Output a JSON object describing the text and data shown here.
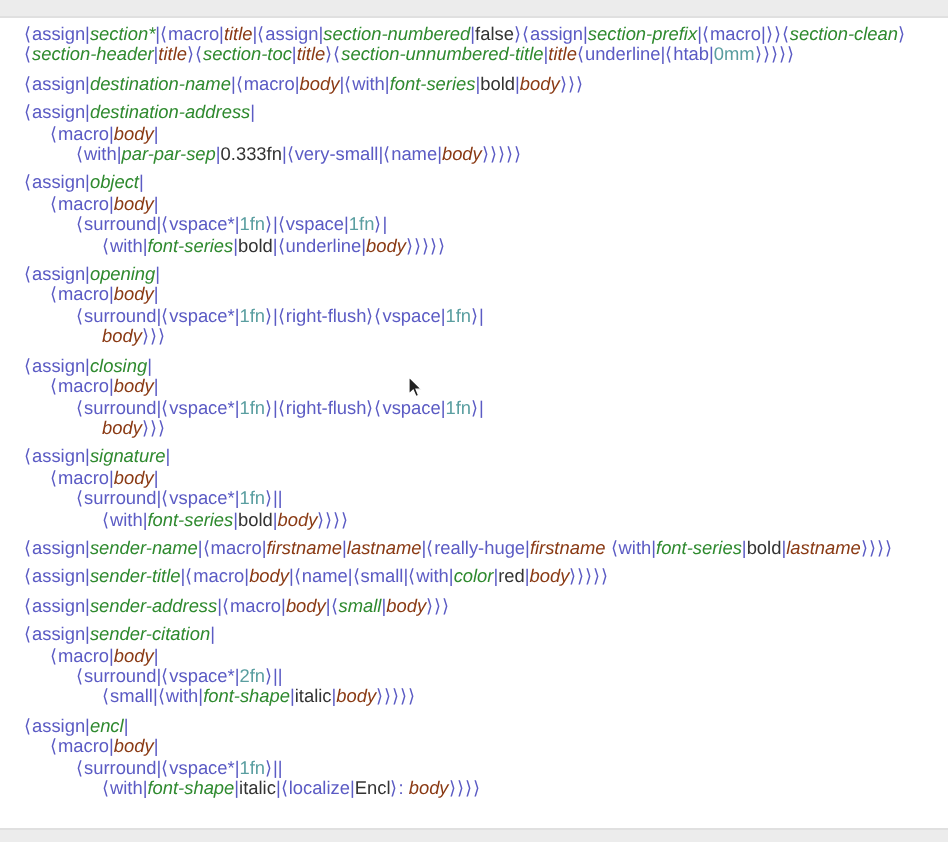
{
  "blocks": [
    {
      "tokens": [
        {
          "kind": "tag",
          "text": "⟨assign|"
        },
        {
          "kind": "var",
          "text": "section*"
        },
        {
          "kind": "tag",
          "text": "|⟨macro|"
        },
        {
          "kind": "arg",
          "text": "title"
        },
        {
          "kind": "tag",
          "text": "|⟨assign|"
        },
        {
          "kind": "var",
          "text": "section-numbered"
        },
        {
          "kind": "tag",
          "text": "|"
        },
        {
          "kind": "plain",
          "text": "false"
        },
        {
          "kind": "tag",
          "text": "⟩⟨assign|"
        },
        {
          "kind": "var",
          "text": "section-prefix"
        },
        {
          "kind": "tag",
          "text": "|⟨macro|⟩⟩⟨"
        },
        {
          "kind": "var",
          "text": "section-clean"
        },
        {
          "kind": "tag",
          "text": "⟩⟨"
        },
        {
          "kind": "var",
          "text": "section-header"
        },
        {
          "kind": "tag",
          "text": "|"
        },
        {
          "kind": "arg",
          "text": "title"
        },
        {
          "kind": "tag",
          "text": "⟩⟨"
        },
        {
          "kind": "var",
          "text": "section-toc"
        },
        {
          "kind": "tag",
          "text": "|"
        },
        {
          "kind": "arg",
          "text": "title"
        },
        {
          "kind": "tag",
          "text": "⟩⟨"
        },
        {
          "kind": "var",
          "text": "section-unnumbered-title"
        },
        {
          "kind": "tag",
          "text": "|"
        },
        {
          "kind": "arg",
          "text": "title"
        },
        {
          "kind": "tag",
          "text": "⟨underline|⟨htab|"
        },
        {
          "kind": "num",
          "text": "0mm"
        },
        {
          "kind": "tag",
          "text": "⟩⟩⟩⟩⟩"
        }
      ]
    },
    {
      "tokens": [
        {
          "kind": "tag",
          "text": "⟨assign|"
        },
        {
          "kind": "var",
          "text": "destination-name"
        },
        {
          "kind": "tag",
          "text": "|⟨macro|"
        },
        {
          "kind": "arg",
          "text": "body"
        },
        {
          "kind": "tag",
          "text": "|⟨with|"
        },
        {
          "kind": "var",
          "text": "font-series"
        },
        {
          "kind": "tag",
          "text": "|"
        },
        {
          "kind": "plain",
          "text": "bold"
        },
        {
          "kind": "tag",
          "text": "|"
        },
        {
          "kind": "arg",
          "text": "body"
        },
        {
          "kind": "tag",
          "text": "⟩⟩⟩"
        }
      ]
    },
    {
      "tokens": [
        {
          "kind": "tag",
          "text": "⟨assign|"
        },
        {
          "kind": "var",
          "text": "destination-address"
        },
        {
          "kind": "tag",
          "text": "|"
        }
      ],
      "children": [
        {
          "tokens": [
            {
              "kind": "tag",
              "text": "⟨macro|"
            },
            {
              "kind": "arg",
              "text": "body"
            },
            {
              "kind": "tag",
              "text": "|"
            }
          ],
          "children": [
            {
              "tokens": [
                {
                  "kind": "tag",
                  "text": "⟨with|"
                },
                {
                  "kind": "var",
                  "text": "par-par-sep"
                },
                {
                  "kind": "tag",
                  "text": "|"
                },
                {
                  "kind": "plain",
                  "text": "0.333fn"
                },
                {
                  "kind": "tag",
                  "text": "|⟨very-small|⟨name|"
                },
                {
                  "kind": "arg",
                  "text": "body"
                },
                {
                  "kind": "tag",
                  "text": "⟩⟩⟩⟩⟩"
                }
              ]
            }
          ]
        }
      ]
    },
    {
      "tokens": [
        {
          "kind": "tag",
          "text": "⟨assign|"
        },
        {
          "kind": "var",
          "text": "object"
        },
        {
          "kind": "tag",
          "text": "|"
        }
      ],
      "children": [
        {
          "tokens": [
            {
              "kind": "tag",
              "text": "⟨macro|"
            },
            {
              "kind": "arg",
              "text": "body"
            },
            {
              "kind": "tag",
              "text": "|"
            }
          ],
          "children": [
            {
              "tokens": [
                {
                  "kind": "tag",
                  "text": "⟨surround|⟨vspace*|"
                },
                {
                  "kind": "num",
                  "text": "1fn"
                },
                {
                  "kind": "tag",
                  "text": "⟩|⟨vspace|"
                },
                {
                  "kind": "num",
                  "text": "1fn"
                },
                {
                  "kind": "tag",
                  "text": "⟩|"
                }
              ],
              "children": [
                {
                  "tokens": [
                    {
                      "kind": "tag",
                      "text": "⟨with|"
                    },
                    {
                      "kind": "var",
                      "text": "font-series"
                    },
                    {
                      "kind": "tag",
                      "text": "|"
                    },
                    {
                      "kind": "plain",
                      "text": "bold"
                    },
                    {
                      "kind": "tag",
                      "text": "|⟨underline|"
                    },
                    {
                      "kind": "arg",
                      "text": "body"
                    },
                    {
                      "kind": "tag",
                      "text": "⟩⟩⟩⟩⟩"
                    }
                  ]
                }
              ]
            }
          ]
        }
      ]
    },
    {
      "tokens": [
        {
          "kind": "tag",
          "text": "⟨assign|"
        },
        {
          "kind": "var",
          "text": "opening"
        },
        {
          "kind": "tag",
          "text": "|"
        }
      ],
      "children": [
        {
          "tokens": [
            {
              "kind": "tag",
              "text": "⟨macro|"
            },
            {
              "kind": "arg",
              "text": "body"
            },
            {
              "kind": "tag",
              "text": "|"
            }
          ],
          "children": [
            {
              "tokens": [
                {
                  "kind": "tag",
                  "text": "⟨surround|⟨vspace*|"
                },
                {
                  "kind": "num",
                  "text": "1fn"
                },
                {
                  "kind": "tag",
                  "text": "⟩|⟨right-flush⟩⟨vspace|"
                },
                {
                  "kind": "num",
                  "text": "1fn"
                },
                {
                  "kind": "tag",
                  "text": "⟩|"
                }
              ],
              "children": [
                {
                  "tokens": [
                    {
                      "kind": "arg",
                      "text": "body"
                    },
                    {
                      "kind": "tag",
                      "text": "⟩⟩⟩"
                    }
                  ]
                }
              ]
            }
          ]
        }
      ]
    },
    {
      "tokens": [
        {
          "kind": "tag",
          "text": "⟨assign|"
        },
        {
          "kind": "var",
          "text": "closing"
        },
        {
          "kind": "tag",
          "text": "|"
        }
      ],
      "children": [
        {
          "tokens": [
            {
              "kind": "tag",
              "text": "⟨macro|"
            },
            {
              "kind": "arg",
              "text": "body"
            },
            {
              "kind": "tag",
              "text": "|"
            }
          ],
          "children": [
            {
              "tokens": [
                {
                  "kind": "tag",
                  "text": "⟨surround|⟨vspace*|"
                },
                {
                  "kind": "num",
                  "text": "1fn"
                },
                {
                  "kind": "tag",
                  "text": "⟩|⟨right-flush⟩⟨vspace|"
                },
                {
                  "kind": "num",
                  "text": "1fn"
                },
                {
                  "kind": "tag",
                  "text": "⟩|"
                }
              ],
              "children": [
                {
                  "tokens": [
                    {
                      "kind": "arg",
                      "text": "body"
                    },
                    {
                      "kind": "tag",
                      "text": "⟩⟩⟩"
                    }
                  ]
                }
              ]
            }
          ]
        }
      ]
    },
    {
      "tokens": [
        {
          "kind": "tag",
          "text": "⟨assign|"
        },
        {
          "kind": "var",
          "text": "signature"
        },
        {
          "kind": "tag",
          "text": "|"
        }
      ],
      "children": [
        {
          "tokens": [
            {
              "kind": "tag",
              "text": "⟨macro|"
            },
            {
              "kind": "arg",
              "text": "body"
            },
            {
              "kind": "tag",
              "text": "|"
            }
          ],
          "children": [
            {
              "tokens": [
                {
                  "kind": "tag",
                  "text": "⟨surround|⟨vspace*|"
                },
                {
                  "kind": "num",
                  "text": "1fn"
                },
                {
                  "kind": "tag",
                  "text": "⟩||"
                }
              ],
              "children": [
                {
                  "tokens": [
                    {
                      "kind": "tag",
                      "text": "⟨with|"
                    },
                    {
                      "kind": "var",
                      "text": "font-series"
                    },
                    {
                      "kind": "tag",
                      "text": "|"
                    },
                    {
                      "kind": "plain",
                      "text": "bold"
                    },
                    {
                      "kind": "tag",
                      "text": "|"
                    },
                    {
                      "kind": "arg",
                      "text": "body"
                    },
                    {
                      "kind": "tag",
                      "text": "⟩⟩⟩⟩"
                    }
                  ]
                }
              ]
            }
          ]
        }
      ]
    },
    {
      "tokens": [
        {
          "kind": "tag",
          "text": "⟨assign|"
        },
        {
          "kind": "var",
          "text": "sender-name"
        },
        {
          "kind": "tag",
          "text": "|⟨macro|"
        },
        {
          "kind": "arg",
          "text": "firstname"
        },
        {
          "kind": "tag",
          "text": "|"
        },
        {
          "kind": "arg",
          "text": "lastname"
        },
        {
          "kind": "tag",
          "text": "|⟨really-huge|"
        },
        {
          "kind": "arg",
          "text": "firstname"
        },
        {
          "kind": "tag",
          "text": " ⟨with|"
        },
        {
          "kind": "var",
          "text": "font-series"
        },
        {
          "kind": "tag",
          "text": "|"
        },
        {
          "kind": "plain",
          "text": "bold"
        },
        {
          "kind": "tag",
          "text": "|"
        },
        {
          "kind": "arg",
          "text": "lastname"
        },
        {
          "kind": "tag",
          "text": "⟩⟩⟩⟩"
        }
      ]
    },
    {
      "tokens": [
        {
          "kind": "tag",
          "text": "⟨assign|"
        },
        {
          "kind": "var",
          "text": "sender-title"
        },
        {
          "kind": "tag",
          "text": "|⟨macro|"
        },
        {
          "kind": "arg",
          "text": "body"
        },
        {
          "kind": "tag",
          "text": "|⟨name|⟨small|⟨with|"
        },
        {
          "kind": "var",
          "text": "color"
        },
        {
          "kind": "tag",
          "text": "|"
        },
        {
          "kind": "plain",
          "text": "red"
        },
        {
          "kind": "tag",
          "text": "|"
        },
        {
          "kind": "arg",
          "text": "body"
        },
        {
          "kind": "tag",
          "text": "⟩⟩⟩⟩⟩"
        }
      ]
    },
    {
      "tokens": [
        {
          "kind": "tag",
          "text": "⟨assign|"
        },
        {
          "kind": "var",
          "text": "sender-address"
        },
        {
          "kind": "tag",
          "text": "|⟨macro|"
        },
        {
          "kind": "arg",
          "text": "body"
        },
        {
          "kind": "tag",
          "text": "|⟨"
        },
        {
          "kind": "var",
          "text": "small"
        },
        {
          "kind": "tag",
          "text": "|"
        },
        {
          "kind": "arg",
          "text": "body"
        },
        {
          "kind": "tag",
          "text": "⟩⟩⟩"
        }
      ]
    },
    {
      "tokens": [
        {
          "kind": "tag",
          "text": "⟨assign|"
        },
        {
          "kind": "var",
          "text": "sender-citation"
        },
        {
          "kind": "tag",
          "text": "|"
        }
      ],
      "children": [
        {
          "tokens": [
            {
              "kind": "tag",
              "text": "⟨macro|"
            },
            {
              "kind": "arg",
              "text": "body"
            },
            {
              "kind": "tag",
              "text": "|"
            }
          ],
          "children": [
            {
              "tokens": [
                {
                  "kind": "tag",
                  "text": "⟨surround|⟨vspace*|"
                },
                {
                  "kind": "num",
                  "text": "2fn"
                },
                {
                  "kind": "tag",
                  "text": "⟩||"
                }
              ],
              "children": [
                {
                  "tokens": [
                    {
                      "kind": "tag",
                      "text": "⟨small|⟨with|"
                    },
                    {
                      "kind": "var",
                      "text": "font-shape"
                    },
                    {
                      "kind": "tag",
                      "text": "|"
                    },
                    {
                      "kind": "plain",
                      "text": "italic"
                    },
                    {
                      "kind": "tag",
                      "text": "|"
                    },
                    {
                      "kind": "arg",
                      "text": "body"
                    },
                    {
                      "kind": "tag",
                      "text": "⟩⟩⟩⟩⟩"
                    }
                  ]
                }
              ]
            }
          ]
        }
      ]
    },
    {
      "tokens": [
        {
          "kind": "tag",
          "text": "⟨assign|"
        },
        {
          "kind": "var",
          "text": "encl"
        },
        {
          "kind": "tag",
          "text": "|"
        }
      ],
      "children": [
        {
          "tokens": [
            {
              "kind": "tag",
              "text": "⟨macro|"
            },
            {
              "kind": "arg",
              "text": "body"
            },
            {
              "kind": "tag",
              "text": "|"
            }
          ],
          "children": [
            {
              "tokens": [
                {
                  "kind": "tag",
                  "text": "⟨surround|⟨vspace*|"
                },
                {
                  "kind": "num",
                  "text": "1fn"
                },
                {
                  "kind": "tag",
                  "text": "⟩||"
                }
              ],
              "children": [
                {
                  "tokens": [
                    {
                      "kind": "tag",
                      "text": "⟨with|"
                    },
                    {
                      "kind": "var",
                      "text": "font-shape"
                    },
                    {
                      "kind": "tag",
                      "text": "|"
                    },
                    {
                      "kind": "plain",
                      "text": "italic"
                    },
                    {
                      "kind": "tag",
                      "text": "|⟨localize|"
                    },
                    {
                      "kind": "plain",
                      "text": "Encl"
                    },
                    {
                      "kind": "tag",
                      "text": "⟩: "
                    },
                    {
                      "kind": "arg",
                      "text": "body"
                    },
                    {
                      "kind": "tag",
                      "text": "⟩⟩⟩⟩"
                    }
                  ]
                }
              ]
            }
          ]
        }
      ]
    }
  ]
}
